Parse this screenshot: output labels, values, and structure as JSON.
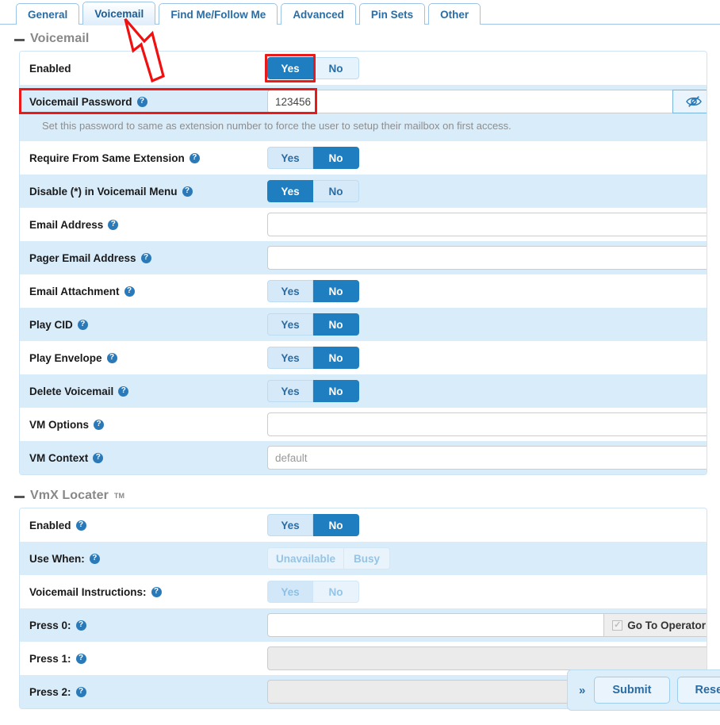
{
  "tabs": [
    {
      "label": "General",
      "active": false
    },
    {
      "label": "Voicemail",
      "active": true
    },
    {
      "label": "Find Me/Follow Me",
      "active": false
    },
    {
      "label": "Advanced",
      "active": false
    },
    {
      "label": "Pin Sets",
      "active": false
    },
    {
      "label": "Other",
      "active": false
    }
  ],
  "voicemail_section": {
    "title": "Voicemail",
    "enabled": {
      "label": "Enabled",
      "yes": "Yes",
      "no": "No",
      "selected": "Yes"
    },
    "password": {
      "label": "Voicemail Password",
      "value": "123456",
      "toggle_icon": "eye-slash-icon",
      "hint": "Set this password to same as extension number to force the user to setup their mailbox on first access."
    },
    "require_from_same_extension": {
      "label": "Require From Same Extension",
      "yes": "Yes",
      "no": "No",
      "selected": "No"
    },
    "disable_star": {
      "label": "Disable (*) in Voicemail Menu",
      "yes": "Yes",
      "no": "No",
      "selected": "Yes"
    },
    "email_address": {
      "label": "Email Address",
      "value": "",
      "placeholder": ""
    },
    "pager_email_address": {
      "label": "Pager Email Address",
      "value": "",
      "placeholder": ""
    },
    "email_attachment": {
      "label": "Email Attachment",
      "yes": "Yes",
      "no": "No",
      "selected": "No"
    },
    "play_cid": {
      "label": "Play CID",
      "yes": "Yes",
      "no": "No",
      "selected": "No"
    },
    "play_envelope": {
      "label": "Play Envelope",
      "yes": "Yes",
      "no": "No",
      "selected": "No"
    },
    "delete_voicemail": {
      "label": "Delete Voicemail",
      "yes": "Yes",
      "no": "No",
      "selected": "No"
    },
    "vm_options": {
      "label": "VM Options",
      "value": "",
      "placeholder": ""
    },
    "vm_context": {
      "label": "VM Context",
      "value": "",
      "placeholder": "default"
    }
  },
  "vmx_section": {
    "title": "VmX Locater",
    "trademark": "TM",
    "enabled": {
      "label": "Enabled",
      "yes": "Yes",
      "no": "No",
      "selected": "No"
    },
    "use_when": {
      "label": "Use When:",
      "option1": "Unavailable",
      "option2": "Busy",
      "disabled": true
    },
    "voicemail_instructions": {
      "label": "Voicemail Instructions:",
      "yes": "Yes",
      "no": "No",
      "selected": "Yes",
      "disabled": true
    },
    "press0": {
      "label": "Press 0:",
      "value": "",
      "addon_label": "Go To Operator",
      "checked": true,
      "disabled": false
    },
    "press1": {
      "label": "Press 1:",
      "value": "",
      "disabled": true
    },
    "press2": {
      "label": "Press 2:",
      "value": "",
      "disabled": true
    }
  },
  "floating_bar": {
    "expand_icon": "»",
    "submit_label": "Submit",
    "reset_label": "Reset"
  },
  "annotations": {
    "arrow_target": "Voicemail tab",
    "highlight_color": "#e81a1a"
  }
}
